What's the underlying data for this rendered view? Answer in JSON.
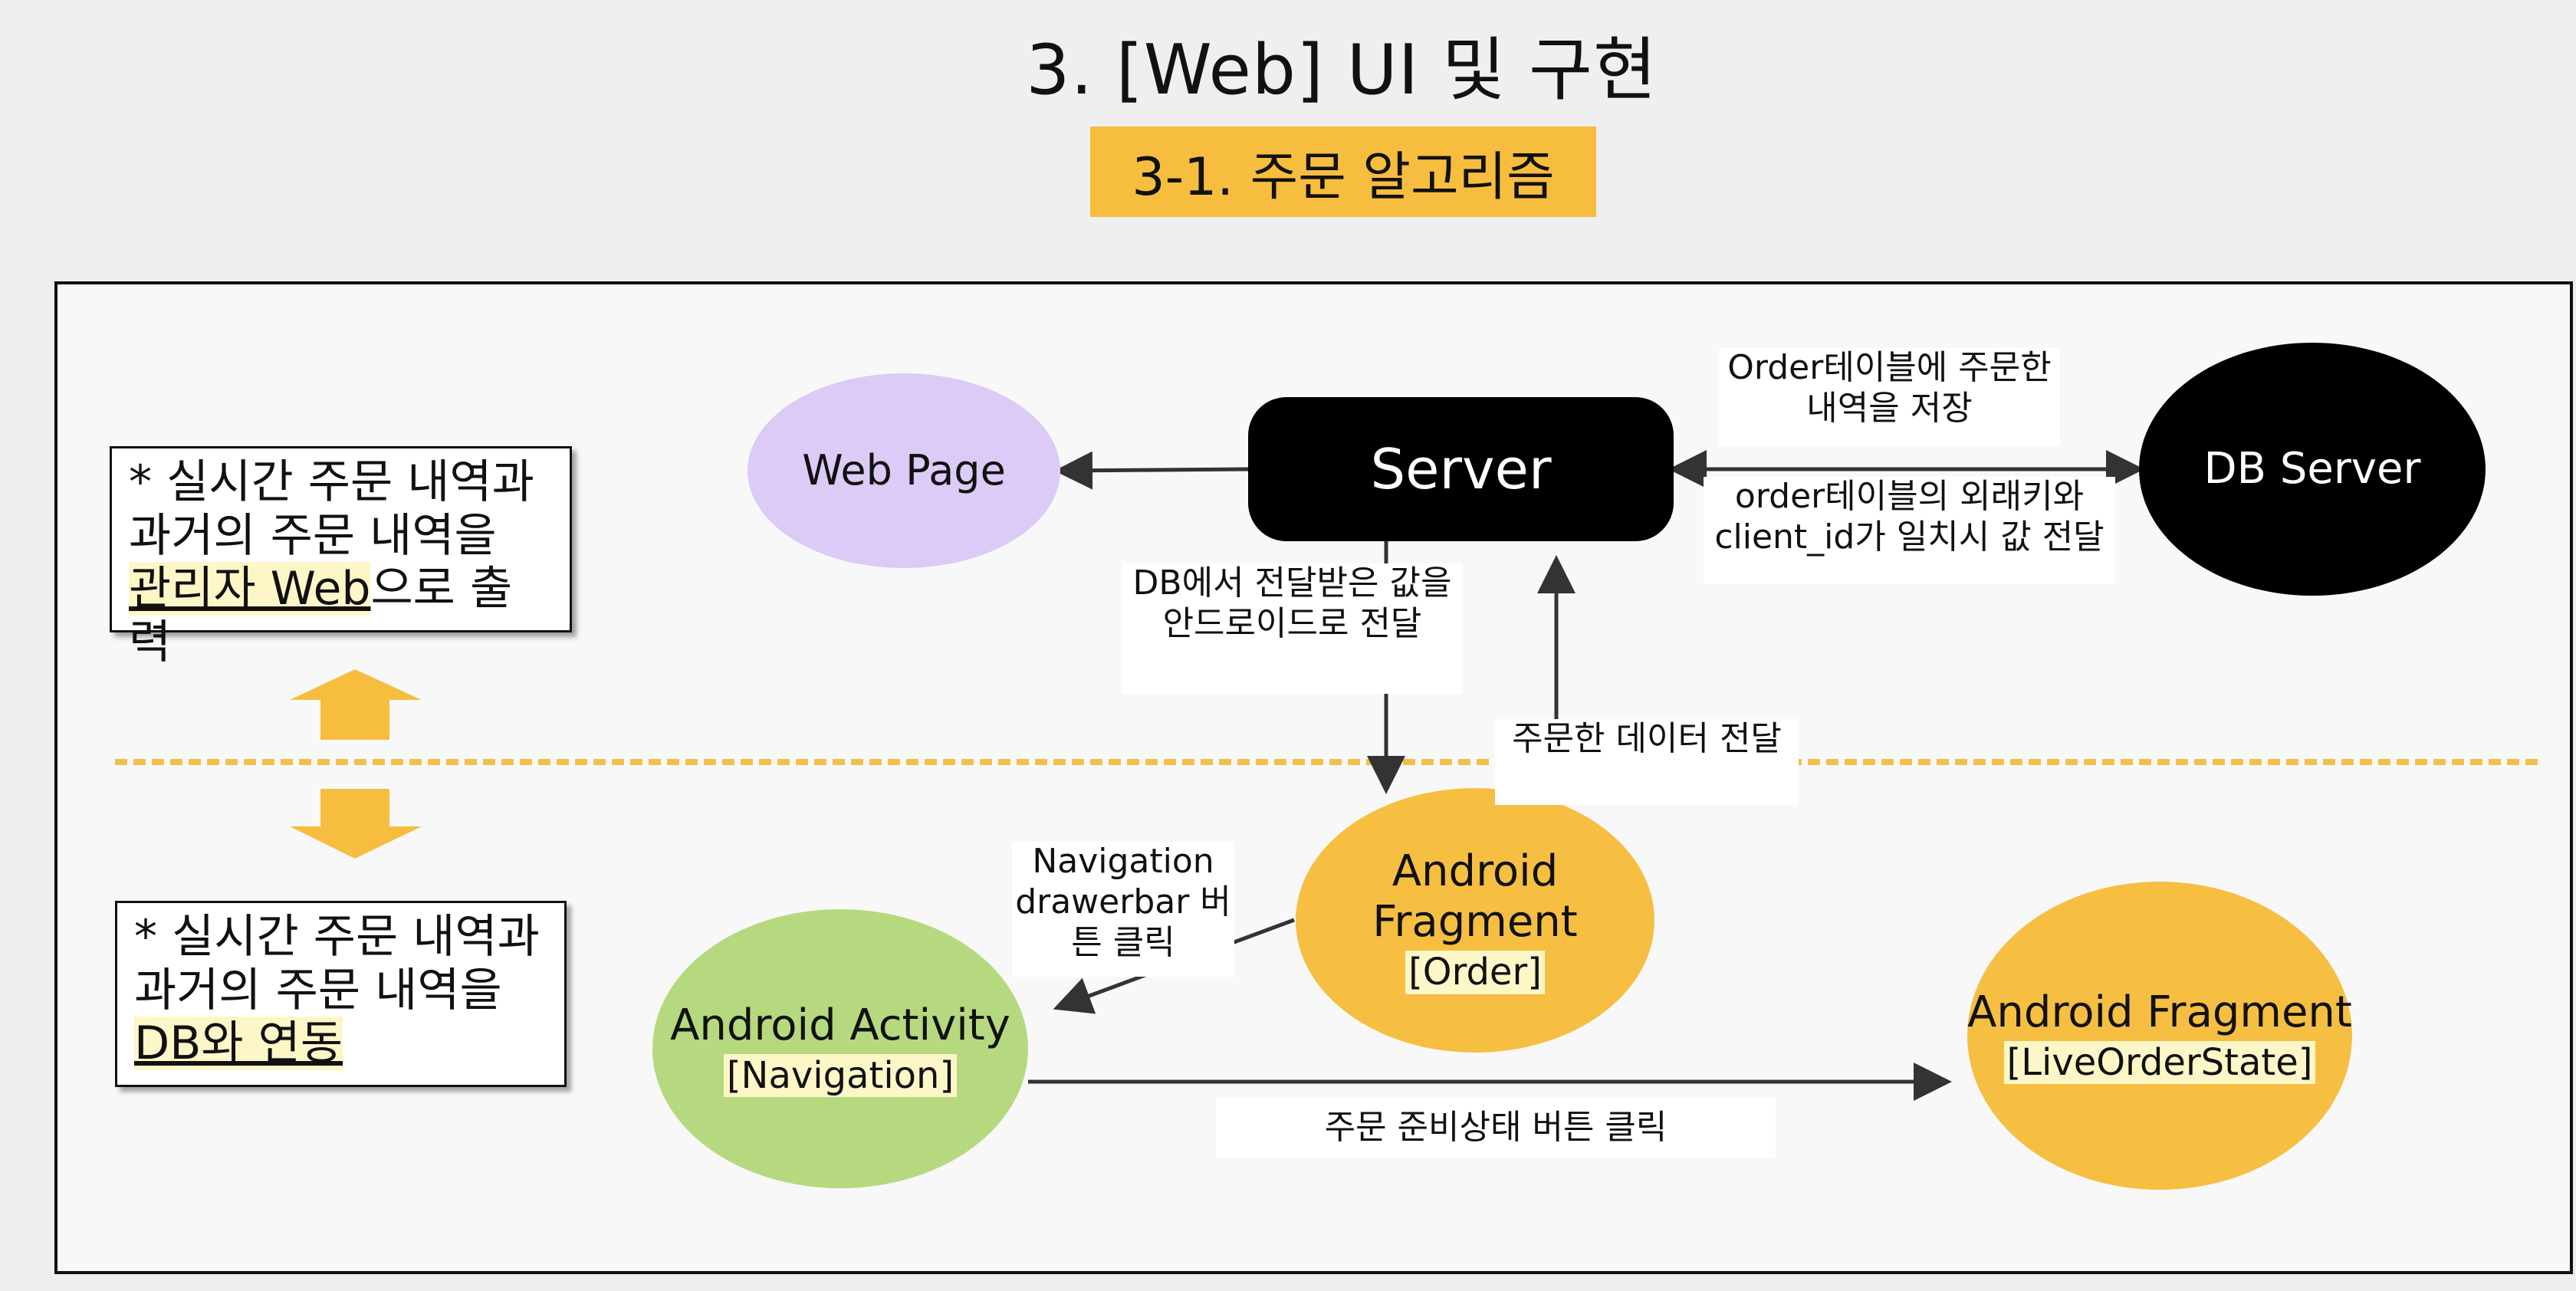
{
  "header": {
    "title": "3. [Web] UI 및 구현",
    "subtitle": "3-1. 주문 알고리즘"
  },
  "colors": {
    "accent": "#f7bd3f",
    "web_page": "#dccaf7",
    "activity": "#b6d97f",
    "fragment": "#f6bf42",
    "server": "#000000"
  },
  "notes": {
    "web": {
      "text": "* 실시간 주문 내역과 과거의 주문 내역을 ",
      "highlight": "관리자 Web",
      "suffix": "으로 출력"
    },
    "db": {
      "text": "* 실시간 주문 내역과 과거의 주문 내역을 ",
      "highlight": "DB와 연동",
      "suffix": ""
    }
  },
  "nodes": {
    "web_page": "Web Page",
    "server": "Server",
    "db_server": "DB Server",
    "frag_order": {
      "title": "Android Fragment",
      "tag": "[Order]"
    },
    "activity": {
      "title": "Android Activity",
      "tag": "[Navigation]"
    },
    "frag_live": {
      "title": "Android Fragment",
      "tag": "[LiveOrderState]"
    }
  },
  "labels": {
    "order_save": "Order테이블에 주문한 내역을 저장",
    "fk_match": "order테이블의 외래키와 client_id가 일치시 값 전달",
    "db_to_android": "DB에서 전달받은 값을 안드로이드로 전달",
    "order_data": "주문한 데이터 전달",
    "nav_click": "Navigation drawerbar 버튼 클릭",
    "ready_click": "주문 준비상태 버튼 클릭"
  }
}
